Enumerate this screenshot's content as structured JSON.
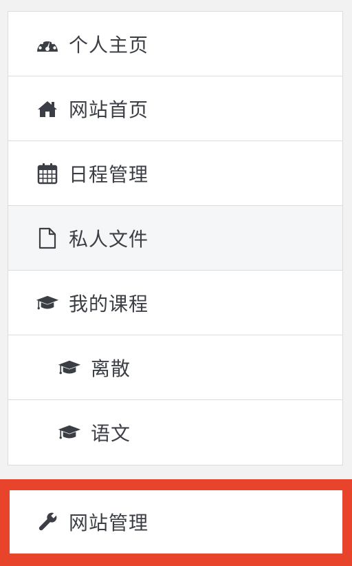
{
  "nav": {
    "items": [
      {
        "label": "个人主页",
        "icon": "dashboard-icon"
      },
      {
        "label": "网站首页",
        "icon": "home-icon"
      },
      {
        "label": "日程管理",
        "icon": "calendar-icon"
      },
      {
        "label": "私人文件",
        "icon": "file-icon"
      },
      {
        "label": "我的课程",
        "icon": "graduation-cap-icon"
      },
      {
        "label": "离散",
        "icon": "graduation-cap-icon"
      },
      {
        "label": "语文",
        "icon": "graduation-cap-icon"
      }
    ]
  },
  "admin": {
    "label": "网站管理",
    "icon": "wrench-icon"
  },
  "colors": {
    "text": "#3b3f45",
    "highlight": "#e8432b",
    "active_bg": "#f5f6f8"
  }
}
